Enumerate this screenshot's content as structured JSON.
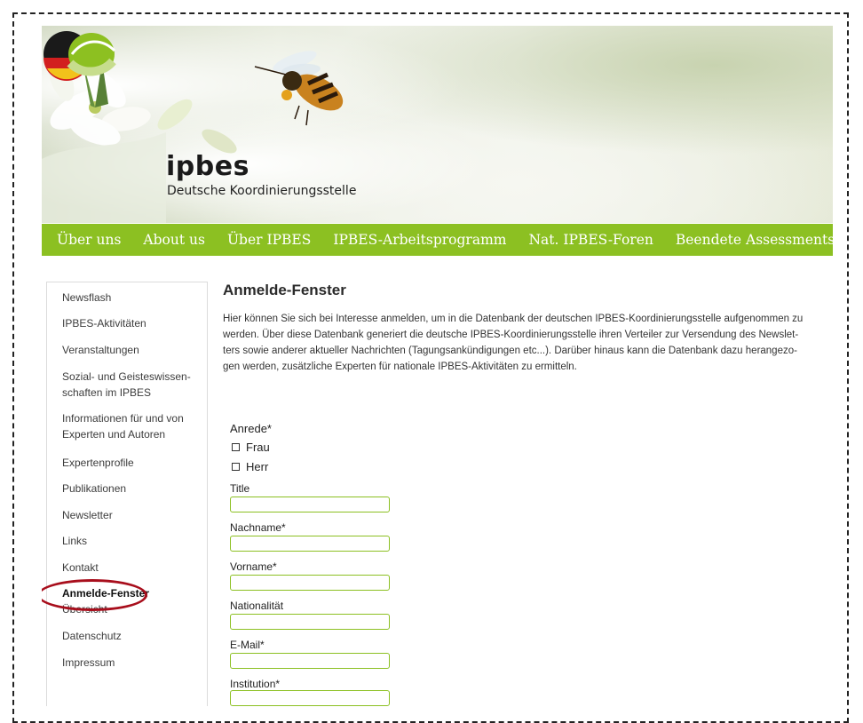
{
  "header": {
    "logo_title": "ipbes",
    "logo_subtitle": "Deutsche Koordinierungsstelle"
  },
  "topnav": [
    "Über uns",
    "About us",
    "Über IPBES",
    "IPBES-Arbeitsprogramm",
    "Nat. IPBES-Foren",
    "Beendete Assessments"
  ],
  "sidebar": {
    "items": [
      "Newsflash",
      "IPBES-Aktivitäten",
      "Veranstaltungen",
      "Sozial- und Geisteswissen-",
      "schaften im IPBES",
      "Informationen für und von",
      "Experten und Autoren",
      "Expertenprofile",
      "Publikationen",
      "Newsletter",
      "Links",
      "Kontakt",
      "Anmelde-Fenster",
      "Übersicht",
      "Datenschutz",
      "Impressum"
    ],
    "active": "Anmelde-Fenster"
  },
  "main": {
    "title": "Anmelde-Fenster",
    "intro_lines": [
      "Hier können Sie sich bei Interesse anmelden, um in die Datenbank der deutschen IPBES-Koordinierungsstelle aufgenommen zu",
      "werden. Über diese Datenbank generiert die deutsche IPBES-Koordinierungsstelle ihren Verteiler zur Versendung des Newslet-",
      "ters sowie anderer aktueller Nachrichten (Tagungsankündigungen etc...). Darüber hinaus kann die Datenbank dazu herangezo-",
      "gen werden, zusätzliche Experten für nationale IPBES-Aktivitäten zu ermitteln."
    ]
  },
  "form": {
    "anrede_label": "Anrede*",
    "options": [
      "Frau",
      "Herr"
    ],
    "fields": [
      "Title",
      "Nachname*",
      "Vorname*",
      "Nationalität",
      "E-Mail*",
      "Institution*"
    ]
  },
  "colors": {
    "nav_green": "#8cc022",
    "highlight_ring": "#a80e1c"
  }
}
